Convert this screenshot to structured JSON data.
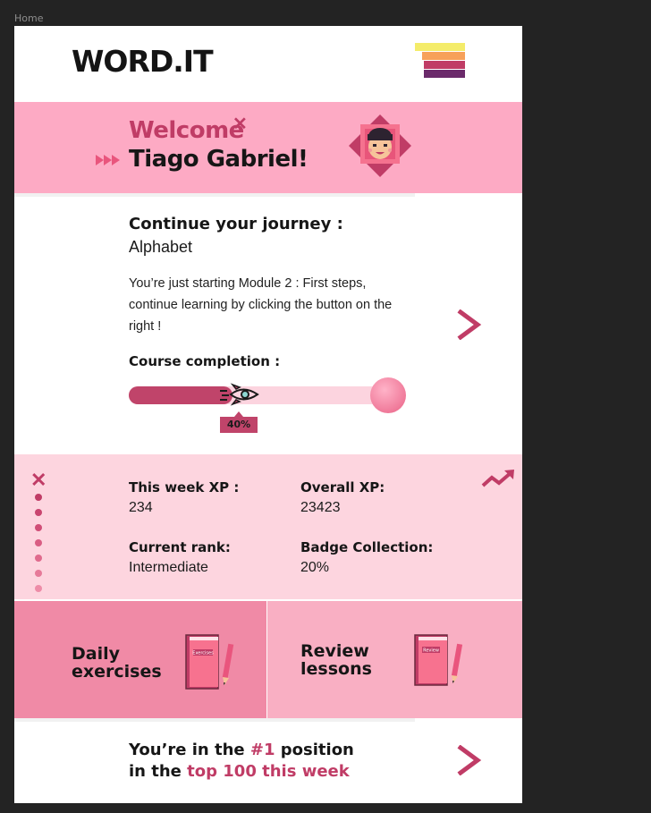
{
  "frame_label": "Home",
  "app": {
    "logo": "WORD.IT"
  },
  "welcome": {
    "greeting": "Welcome",
    "name": "Tiago Gabriel!"
  },
  "journey": {
    "title": "Continue your journey :",
    "course": "Alphabet",
    "description": "You’re just starting Module 2 : First steps, continue learning by clicking the button on the right !",
    "completion_label": "Course completion :",
    "completion_percent": 40,
    "completion_text": "40%"
  },
  "stats": {
    "week_xp_label": "This week XP :",
    "week_xp": "234",
    "overall_xp_label": "Overall  XP:",
    "overall_xp": "23423",
    "rank_label": "Current rank:",
    "rank": "Intermediate",
    "badge_label": "Badge Collection:",
    "badge": "20%"
  },
  "tiles": {
    "daily": {
      "line1": "Daily",
      "line2": "exercises",
      "book_label": "Exercises"
    },
    "review": {
      "line1": "Review",
      "line2": "lessons",
      "book_label": "Review"
    }
  },
  "ranking": {
    "part1": "You’re in the ",
    "position": "#1",
    "part2": " position",
    "part3": "in the ",
    "highlight": "top 100 this week"
  },
  "colors": {
    "accent": "#c03c66",
    "welcome_bg": "#fdaac4",
    "stats_bg": "#fdd5df",
    "tile_left": "#f08aa6",
    "tile_right": "#f9afc3",
    "menu_bars": [
      "#f4ec6a",
      "#f7a15a",
      "#c03c66",
      "#6b2a6b"
    ]
  },
  "icons": [
    "menu-icon",
    "close-icon",
    "fast-forward-icon",
    "avatar",
    "chevron-right-icon",
    "rocket-icon",
    "planet-icon",
    "trend-up-icon",
    "book-icon",
    "pencil-icon"
  ]
}
